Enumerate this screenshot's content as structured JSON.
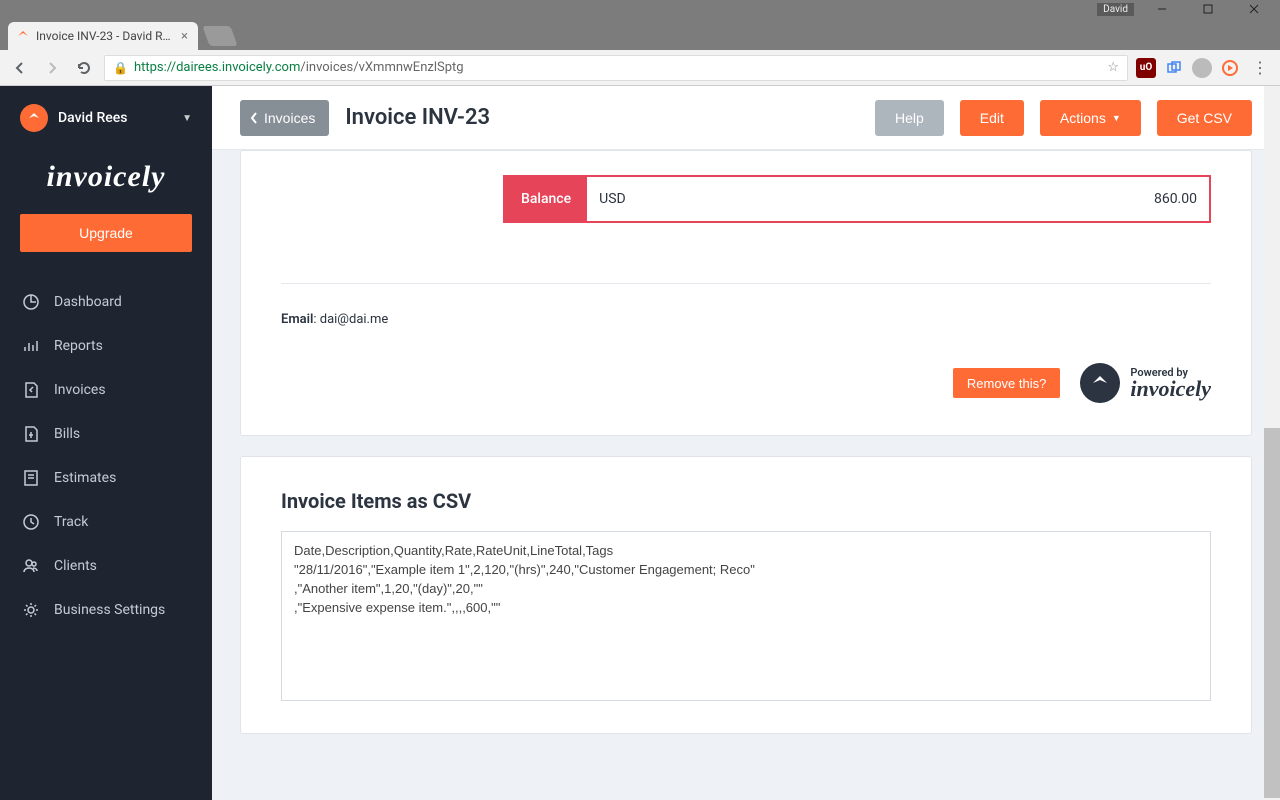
{
  "window": {
    "user_tag": "David"
  },
  "browser": {
    "tab_title": "Invoice INV-23 - David R…",
    "url_host": "https://dairees.invoicely.com",
    "url_path": "/invoices/vXmmnwEnzlSptg"
  },
  "sidebar": {
    "user_name": "David Rees",
    "brand": "invoicely",
    "upgrade": "Upgrade",
    "items": [
      {
        "label": "Dashboard"
      },
      {
        "label": "Reports"
      },
      {
        "label": "Invoices"
      },
      {
        "label": "Bills"
      },
      {
        "label": "Estimates"
      },
      {
        "label": "Track"
      },
      {
        "label": "Clients"
      },
      {
        "label": "Business Settings"
      }
    ]
  },
  "topbar": {
    "back": "Invoices",
    "title": "Invoice INV-23",
    "help": "Help",
    "edit": "Edit",
    "actions": "Actions",
    "get_csv": "Get CSV"
  },
  "invoice": {
    "balance_label": "Balance",
    "currency": "USD",
    "amount": "860.00",
    "email_label": "Email",
    "email_value": ": dai@dai.me",
    "remove": "Remove this?",
    "powered_by": "Powered by",
    "powered_brand": "invoicely"
  },
  "csv": {
    "heading": "Invoice Items as CSV",
    "content": "Date,Description,Quantity,Rate,RateUnit,LineTotal,Tags\n\"28/11/2016\",\"Example item 1\",2,120,\"(hrs)\",240,\"Customer Engagement; Reco\"\n,\"Another item\",1,20,\"(day)\",20,\"\"\n,\"Expensive expense item.\",,,,600,\"\""
  }
}
